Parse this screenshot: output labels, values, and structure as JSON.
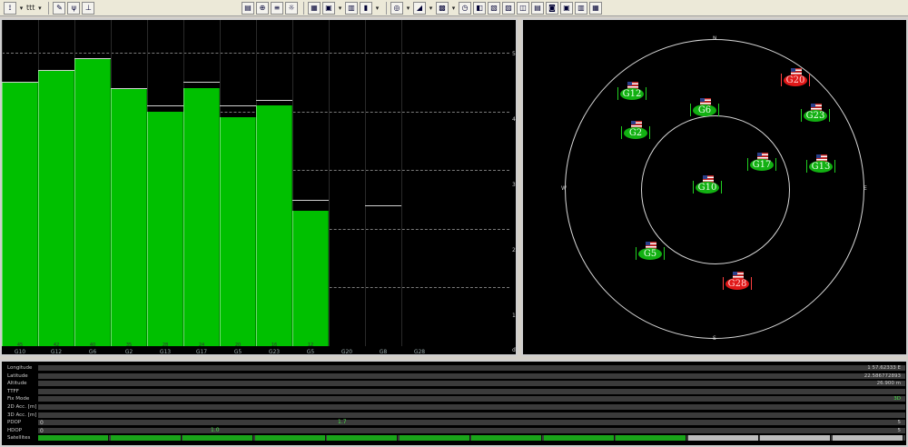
{
  "toolbar": {
    "left_icons": [
      "antenna-icon",
      "signal-icon",
      "pen-icon",
      "antenna-dish-icon"
    ],
    "right_icons": [
      "doc-icon",
      "target-icon",
      "list-icon",
      "gear-icon",
      "grid-icon",
      "map-icon",
      "table-icon",
      "bars-icon",
      "compass-icon",
      "clock-icon",
      "chart-icon",
      "window-icon",
      "status-icon",
      "settings-icon",
      "info-icon"
    ],
    "label_small": "ttt"
  },
  "snr_chart": {
    "y_ticks": [
      "50",
      "40",
      "30",
      "20",
      "10",
      "dB"
    ],
    "satellites": [
      {
        "label": "G10",
        "num": "45",
        "value": 45
      },
      {
        "label": "G12",
        "num": "42",
        "value": 47
      },
      {
        "label": "G6",
        "num": "40",
        "value": 49
      },
      {
        "label": "G2",
        "num": "35",
        "value": 44
      },
      {
        "label": "G13",
        "num": "28",
        "value": 40
      },
      {
        "label": "G17",
        "num": "24",
        "value": 44
      },
      {
        "label": "G5",
        "num": "20",
        "value": 39
      },
      {
        "label": "G23",
        "num": "16",
        "value": 41
      },
      {
        "label": "G5",
        "num": "12",
        "value": 23
      },
      {
        "label": "G20",
        "num": "",
        "value": 0
      },
      {
        "label": "G8",
        "num": "",
        "value": 0
      },
      {
        "label": "G28",
        "num": "",
        "value": 0
      }
    ],
    "max_marks": [
      45,
      47,
      49,
      44,
      41,
      45,
      41,
      42,
      25,
      0,
      24,
      0
    ]
  },
  "sky_view": {
    "directions": {
      "north": "N",
      "south": "S",
      "west": "W",
      "east": "E"
    },
    "satellites": [
      {
        "id": "G20",
        "color": "red",
        "az_el": [
          300,
          95
        ]
      },
      {
        "id": "G12",
        "color": "green",
        "az_el": [
          120,
          110
        ]
      },
      {
        "id": "G6",
        "color": "green",
        "az_el": [
          200,
          128
        ]
      },
      {
        "id": "G23",
        "color": "green",
        "az_el": [
          322,
          134
        ]
      },
      {
        "id": "G2",
        "color": "green",
        "az_el": [
          124,
          153
        ]
      },
      {
        "id": "G17",
        "color": "green",
        "az_el": [
          263,
          188
        ]
      },
      {
        "id": "G13",
        "color": "green",
        "az_el": [
          328,
          190
        ]
      },
      {
        "id": "G10",
        "color": "green",
        "az_el": [
          203,
          213
        ]
      },
      {
        "id": "G5",
        "color": "green",
        "az_el": [
          140,
          286
        ]
      },
      {
        "id": "G28",
        "color": "red",
        "az_el": [
          236,
          319
        ]
      }
    ]
  },
  "status": {
    "rows": [
      {
        "label": "Longitude",
        "value": "1 57.62333 E"
      },
      {
        "label": "Latitude",
        "value": "22.586772893"
      },
      {
        "label": "Altitude",
        "value": "26.900 m"
      },
      {
        "label": "TTFF",
        "value": ""
      },
      {
        "label": "Fix Mode",
        "value": "3D"
      },
      {
        "label": "2D Acc. [m]",
        "value": ""
      },
      {
        "label": "3D Acc. [m]",
        "value": ""
      },
      {
        "label": "PDOP",
        "value": "5"
      },
      {
        "label": "HDOP",
        "value": "5"
      },
      {
        "label": "Satellites",
        "value": ""
      }
    ],
    "pdop_left": "0",
    "pdop_mark": "1.7",
    "hdop_left": "0",
    "hdop_mark": "1.0",
    "sat_segments": [
      "green",
      "green",
      "green",
      "green",
      "green",
      "green",
      "green",
      "green",
      "green",
      "gray",
      "gray",
      "gray"
    ]
  }
}
